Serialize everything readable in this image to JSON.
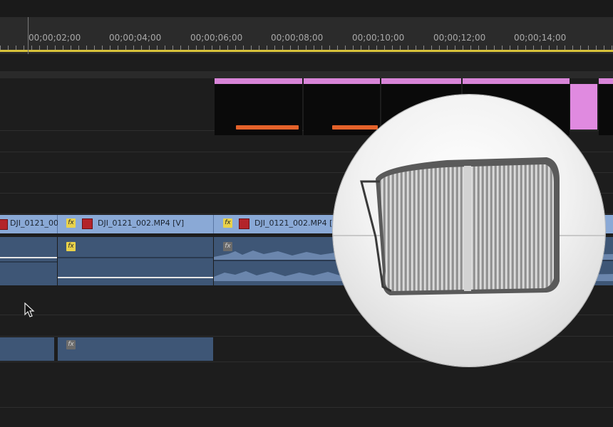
{
  "timeline": {
    "ruler_ticks": [
      "00;00;02;00",
      "00;00;04;00",
      "00;00;06;00",
      "00;00;08;00",
      "00;00;10;00",
      "00;00;12;00",
      "00;00;14;00"
    ],
    "video_clips": [
      {
        "label": "DJI_0121_00",
        "fx": true
      },
      {
        "label": "DJI_0121_002.MP4 [V]",
        "fx": true
      },
      {
        "label": "DJI_0121_002.MP4 [V]",
        "fx": true
      }
    ],
    "fx_label": "fx"
  },
  "colors": {
    "title_track": "#d884d8",
    "video_clip": "#8aa9d6",
    "audio_clip": "#3e5676",
    "work_area_bar": "#d8c23a"
  },
  "icons": [
    "fx-badge-icon",
    "clip-marker-icon",
    "mouse-pointer-icon",
    "scroll-wheel-icon"
  ]
}
